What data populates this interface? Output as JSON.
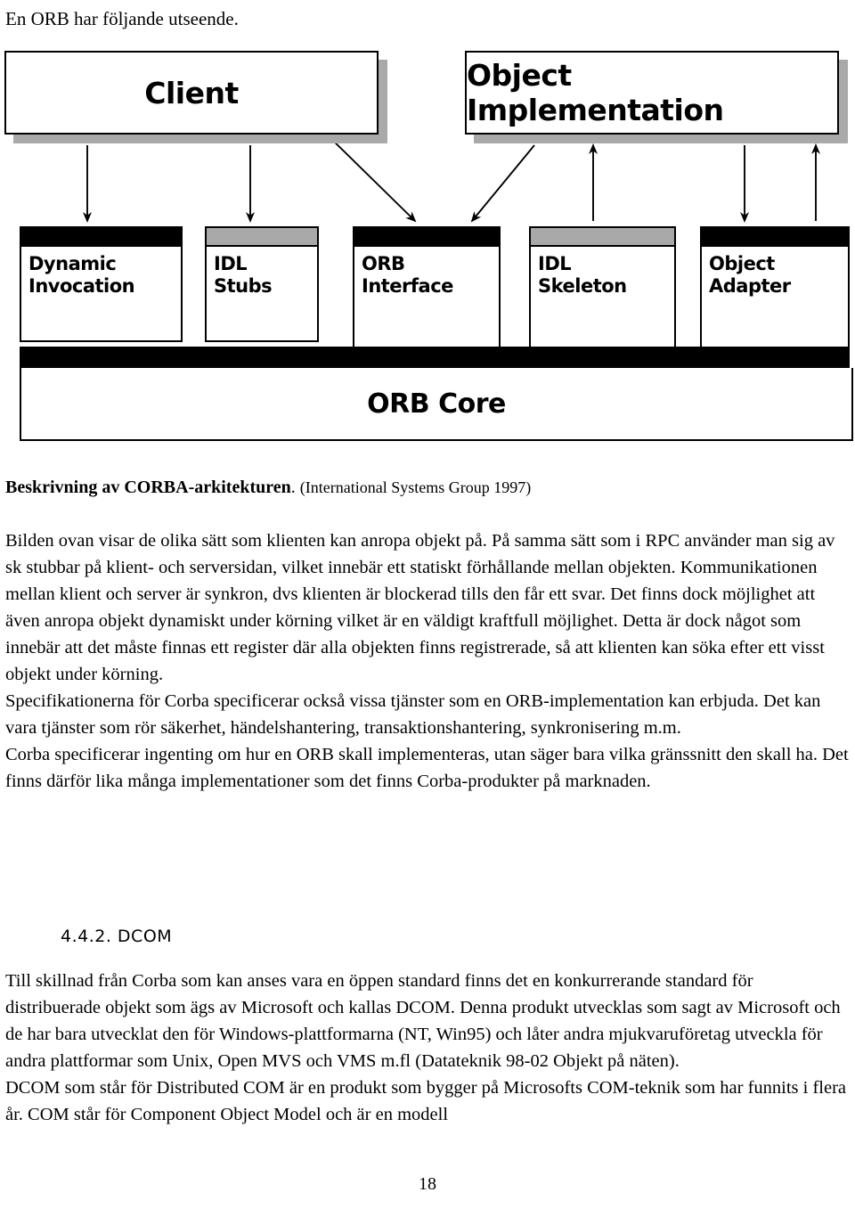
{
  "intro": "En ORB har följande utseende.",
  "figure": {
    "name": "corba-architecture-diagram",
    "top_boxes": [
      {
        "id": "client",
        "label": "Client"
      },
      {
        "id": "object-implementation",
        "label": "Object Implementation"
      }
    ],
    "middle_boxes": [
      {
        "id": "dynamic-invocation",
        "line1": "Dynamic",
        "line2": "Invocation",
        "cap": "black",
        "footer": "none"
      },
      {
        "id": "idl-stubs",
        "line1": "IDL",
        "line2": "Stubs",
        "cap": "gray",
        "footer": "none"
      },
      {
        "id": "orb-interface",
        "line1": "ORB",
        "line2": "Interface",
        "cap": "black",
        "footer": "none"
      },
      {
        "id": "idl-skeleton",
        "line1": "IDL",
        "line2": "Skeleton",
        "cap": "gray",
        "footer": "teal"
      },
      {
        "id": "object-adapter",
        "line1": "Object",
        "line2": "Adapter",
        "cap": "black",
        "footer": "none"
      }
    ],
    "core": {
      "id": "orb-core",
      "label": "ORB Core"
    },
    "colors": {
      "cap_black": "#000000",
      "cap_gray": "#a9a9a9",
      "teal_bar": "#00c88c",
      "shadow": "#a9a9a9",
      "outline": "#000000"
    }
  },
  "caption": {
    "bold": "Beskrivning av CORBA-arkitekturen",
    "tail": ".",
    "source": "(International Systems Group 1997)"
  },
  "body": {
    "paragraph_main": "Bilden ovan visar de olika sätt som klienten kan anropa objekt på. På samma sätt som i RPC använder man sig av sk stubbar på klient- och serversidan, vilket innebär ett statiskt förhållande mellan objekten. Kommunikationen mellan klient och server är synkron, dvs klienten är blockerad tills den får ett svar. Det finns dock möjlighet att även anropa objekt dynamiskt under körning vilket är en väldigt kraftfull möjlighet. Detta är dock något som innebär att det måste finnas ett register där alla objekten finns registrerade, så att klienten kan söka efter ett visst objekt under körning.\nSpecifikationerna för Corba specificerar också vissa tjänster som en ORB-implementation kan erbjuda. Det kan vara tjänster som rör säkerhet, händelshantering, transaktionshantering, synkronisering m.m.\nCorba specificerar ingenting om hur en ORB skall implementeras, utan säger bara vilka gränssnitt den skall ha. Det finns därför lika många implementationer som det finns Corba-produkter på marknaden.",
    "heading_dcom": "4.4.2.  DCOM",
    "paragraph_dcom": "Till skillnad från Corba som kan anses vara en öppen standard finns det en konkurrerande standard för distribuerade objekt som ägs av Microsoft och kallas DCOM. Denna produkt utvecklas som sagt av Microsoft och de har bara utvecklat den för Windows-plattformarna (NT, Win95) och låter andra mjukvaruföretag utveckla för andra plattformar som Unix, Open MVS och VMS m.fl (Datateknik 98-02 Objekt på näten).\nDCOM som står för Distributed COM är en produkt som bygger på Microsofts COM-teknik som har funnits i flera år. COM står för Component Object Model och är en modell"
  },
  "folio": "18"
}
